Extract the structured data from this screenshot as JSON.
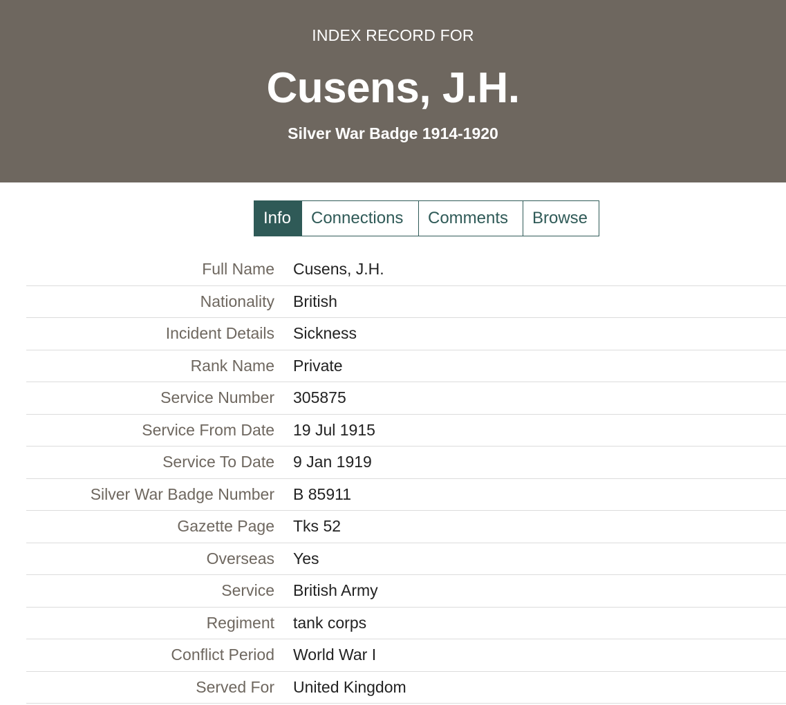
{
  "header": {
    "eyebrow": "INDEX RECORD FOR",
    "name": "Cusens, J.H.",
    "subtitle": "Silver War Badge 1914-1920"
  },
  "tabs": [
    {
      "label": "Info",
      "active": true
    },
    {
      "label": "Connections",
      "active": false
    },
    {
      "label": "Comments",
      "active": false
    },
    {
      "label": "Browse",
      "active": false
    }
  ],
  "records": [
    {
      "label": "Full Name",
      "value": "Cusens, J.H."
    },
    {
      "label": "Nationality",
      "value": "British"
    },
    {
      "label": "Incident Details",
      "value": "Sickness"
    },
    {
      "label": "Rank Name",
      "value": "Private"
    },
    {
      "label": "Service Number",
      "value": "305875"
    },
    {
      "label": "Service From Date",
      "value": "19 Jul 1915"
    },
    {
      "label": "Service To Date",
      "value": "9 Jan 1919"
    },
    {
      "label": "Silver War Badge Number",
      "value": "B 85911"
    },
    {
      "label": "Gazette Page",
      "value": "Tks 52"
    },
    {
      "label": "Overseas",
      "value": "Yes"
    },
    {
      "label": "Service",
      "value": "British Army"
    },
    {
      "label": "Regiment",
      "value": "tank corps"
    },
    {
      "label": "Conflict Period",
      "value": "World War I"
    },
    {
      "label": "Served For",
      "value": "United Kingdom"
    }
  ],
  "colors": {
    "header_bg": "#6e675f",
    "tab_accent": "#2f5a57",
    "label_text": "#6e675f",
    "value_text": "#222222"
  }
}
